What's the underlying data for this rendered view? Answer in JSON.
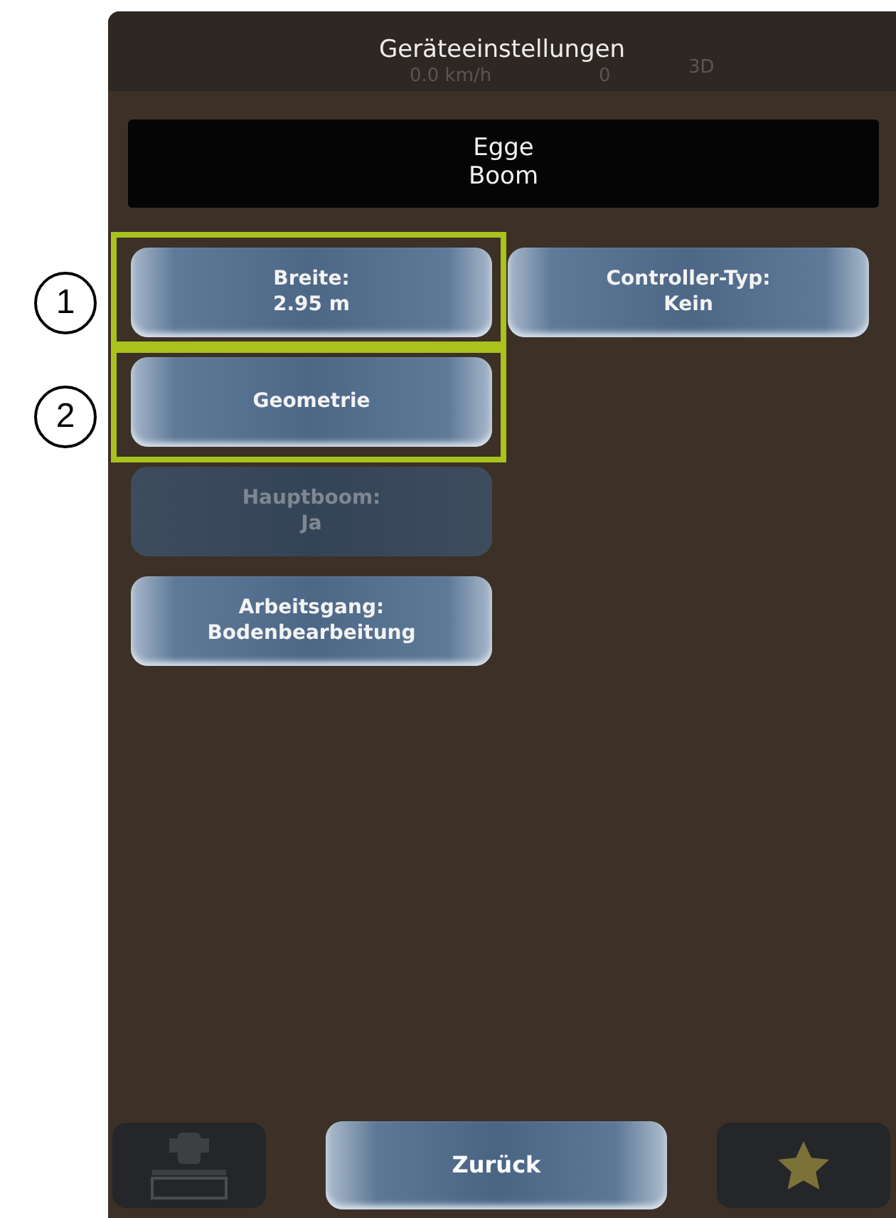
{
  "header": {
    "title": "Geräteeinstellungen",
    "background_status": {
      "speed": "0.0 km/h",
      "count": "0",
      "fix": "3D"
    }
  },
  "device": {
    "lines": [
      "Egge",
      "Boom"
    ]
  },
  "callouts": [
    "1",
    "2"
  ],
  "left_settings": [
    {
      "label": "Breite:",
      "value": "2.95 m",
      "highlighted": true,
      "disabled": false
    },
    {
      "label": "Geometrie",
      "highlighted": true,
      "disabled": false
    },
    {
      "label": "Hauptboom:",
      "value": "Ja",
      "highlighted": false,
      "disabled": true
    },
    {
      "label": "Arbeitsgang:",
      "value": "Bodenbearbeitung",
      "highlighted": false,
      "disabled": false
    }
  ],
  "right_settings": [
    {
      "label": "Controller-Typ:",
      "value": "Kein",
      "highlighted": false,
      "disabled": false
    }
  ],
  "footer": {
    "back_button": "Zurück"
  }
}
